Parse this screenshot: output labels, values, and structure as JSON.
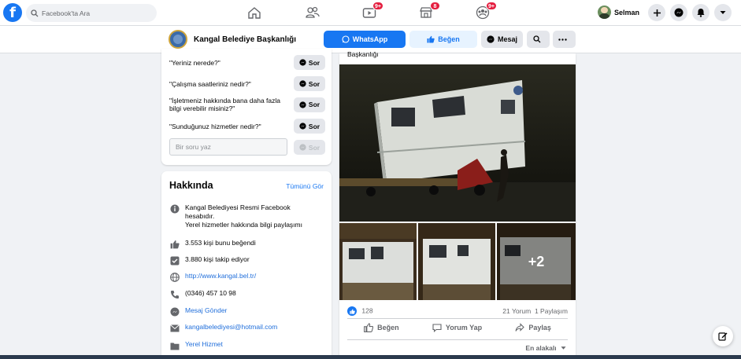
{
  "topbar": {
    "search_placeholder": "Facebook'ta Ara",
    "badges": {
      "watch": "9+",
      "marketplace": "8",
      "groups": "9+"
    },
    "user_name": "Selman"
  },
  "page": {
    "name": "Kangal Belediye Başkanlığı",
    "whatsapp_label": "WhatsApp",
    "like_label": "Beğen",
    "message_label": "Mesaj"
  },
  "questions": {
    "items": [
      "\"Yeriniz nerede?\"",
      "\"Çalışma saatleriniz nedir?\"",
      "\"İşletmeniz hakkında bana daha fazla bilgi verebilir misiniz?\"",
      "\"Sunduğunuz hizmetler nedir?\""
    ],
    "ask_label": "Sor",
    "input_placeholder": "Bir soru yaz"
  },
  "about": {
    "title": "Hakkında",
    "see_all": "Tümünü Gör",
    "description": "Kangal Belediyesi Resmi Facebook hesabıdır.",
    "description2": "Yerel hizmetler hakkında bilgi paylaşımı",
    "likes": "3.553 kişi bunu beğendi",
    "followers": "3.880 kişi takip ediyor",
    "website": "http://www.kangal.bel.tr/",
    "phone": "(0346) 457 10 98",
    "send_message": "Mesaj Gönder",
    "email": "kangalbelediyesi@hotmail.com",
    "category": "Yerel Hizmet"
  },
  "post": {
    "header_text": "Başkanlığı",
    "more_photos": "+2",
    "reactions": "128",
    "comments": "21 Yorum",
    "shares": "1 Paylaşım",
    "like_action": "Beğen",
    "comment_action": "Yorum Yap",
    "share_action": "Paylaş",
    "sort_label": "En alakalı"
  },
  "colors": {
    "brand": "#1877f2",
    "badge": "#e41e3f",
    "whatsapp_button": "#1877f2",
    "like_button_bg": "#e7f3ff"
  }
}
